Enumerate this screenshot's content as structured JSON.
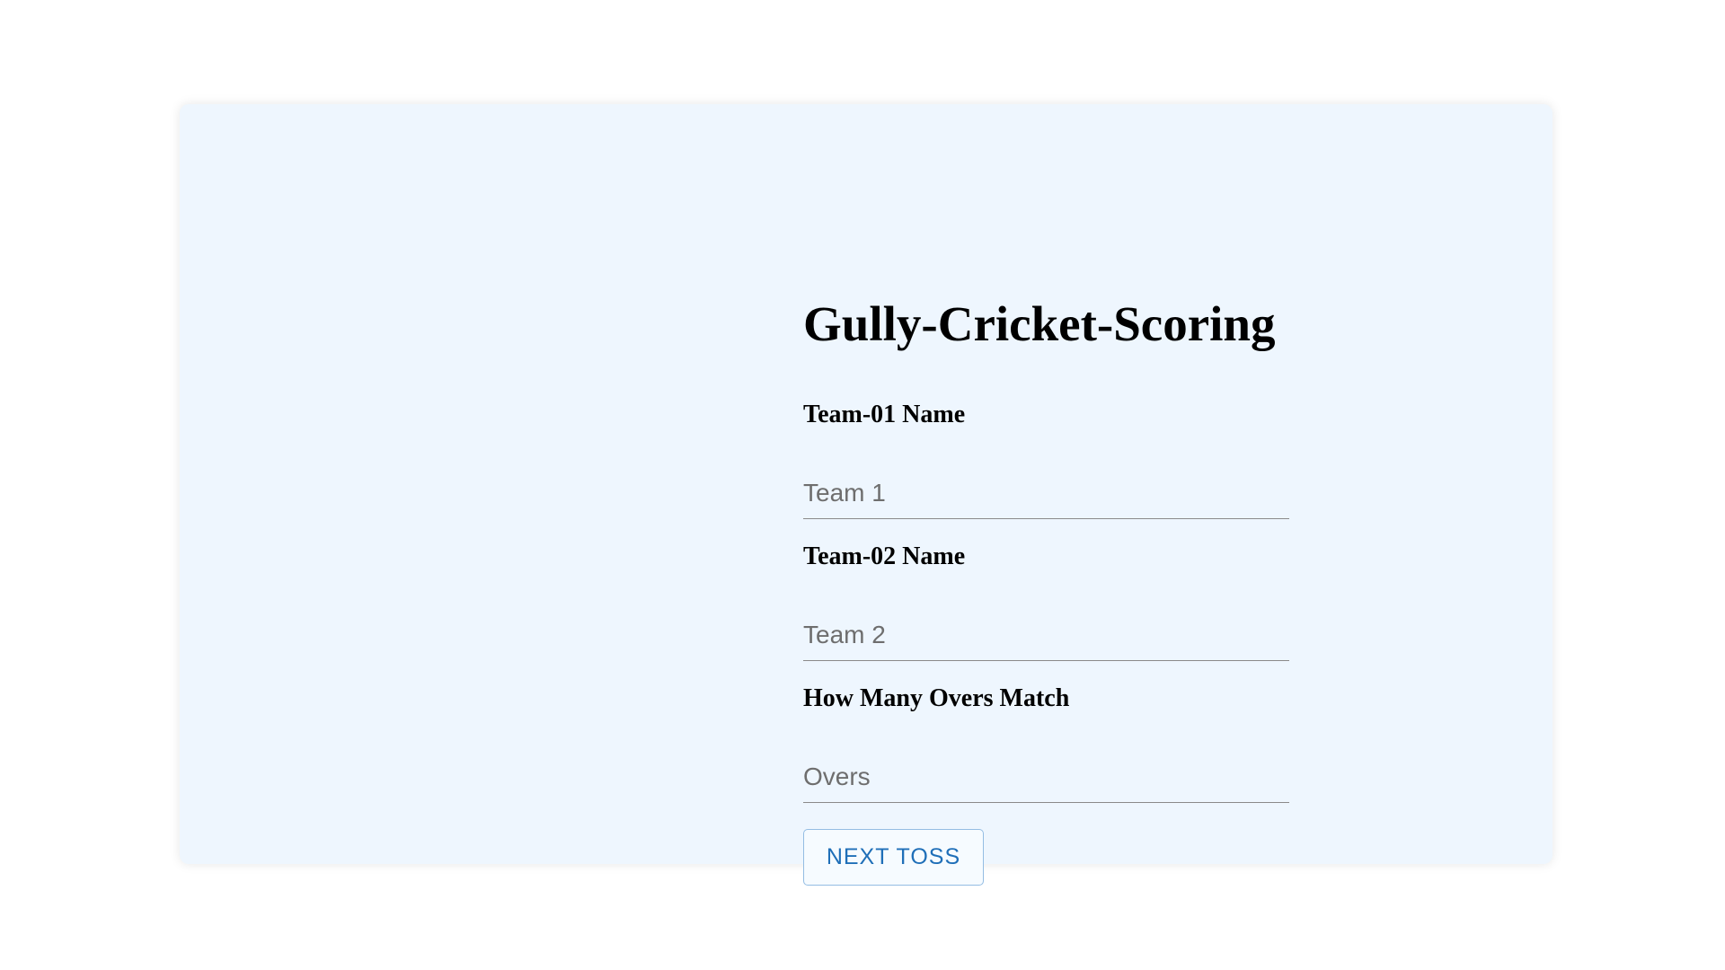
{
  "app": {
    "title": "Gully-Cricket-Scoring"
  },
  "form": {
    "team1": {
      "label": "Team-01 Name",
      "value": "",
      "placeholder": "Team 1"
    },
    "team2": {
      "label": "Team-02 Name",
      "value": "",
      "placeholder": "Team 2"
    },
    "overs": {
      "label": "How Many Overs Match",
      "value": "",
      "placeholder": "Overs"
    },
    "next_button_label": "NEXT TOSS"
  },
  "colors": {
    "card_background": "#eef6fe",
    "button_text": "#1f6fb8",
    "button_border": "#94bde3"
  }
}
